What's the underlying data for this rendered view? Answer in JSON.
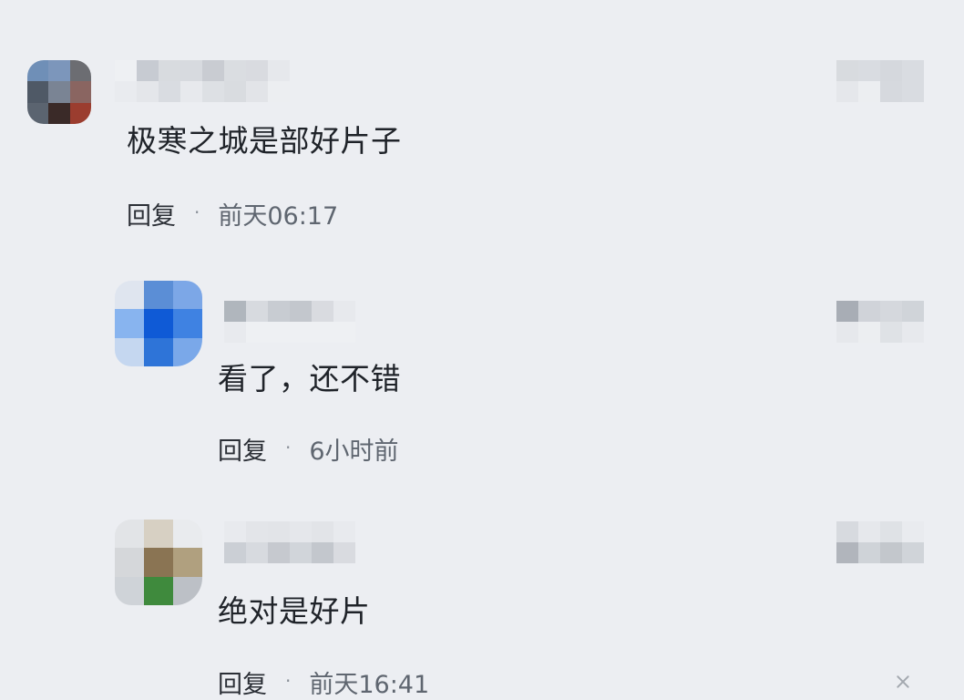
{
  "comments": [
    {
      "content": "极寒之城是部好片子",
      "reply_label": "回复",
      "separator": "·",
      "time": "前天06:17"
    },
    {
      "content": "看了，还不错",
      "reply_label": "回复",
      "separator": "·",
      "time": "6小时前"
    },
    {
      "content": "绝对是好片",
      "reply_label": "回复",
      "separator": "·",
      "time": "前天16:41"
    }
  ],
  "icons": {
    "close": "close-icon"
  }
}
